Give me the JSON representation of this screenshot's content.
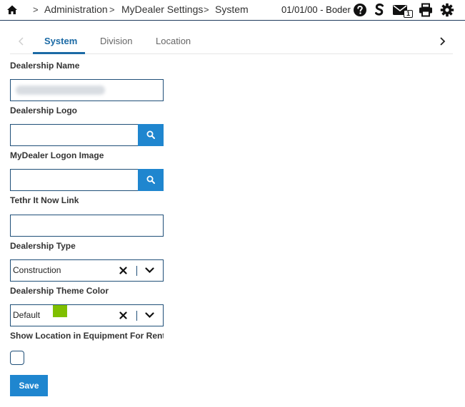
{
  "header": {
    "breadcrumb": [
      "Administration",
      "MyDealer Settings",
      "System"
    ],
    "separator": ">",
    "status_text": "01/01/00 - Boder",
    "mail_badge": "1",
    "icons": [
      "home-icon",
      "help-icon",
      "s-logo-icon",
      "mail-icon",
      "print-icon",
      "gear-icon"
    ]
  },
  "tabs": [
    {
      "label": "System",
      "active": true
    },
    {
      "label": "Division",
      "active": false
    },
    {
      "label": "Location",
      "active": false
    }
  ],
  "form": {
    "dealership_name": {
      "label": "Dealership Name",
      "value": ""
    },
    "dealership_logo": {
      "label": "Dealership Logo",
      "value": ""
    },
    "logon_image": {
      "label": "MyDealer Logon Image",
      "value": ""
    },
    "tethr_link": {
      "label": "Tethr It Now Link",
      "value": ""
    },
    "dealership_type": {
      "label": "Dealership Type",
      "value": "Construction"
    },
    "theme_color": {
      "label": "Dealership Theme Color",
      "value": "Default",
      "swatch": "#7fbf00"
    },
    "show_location": {
      "label": "Show Location in Equipment For Rent",
      "checked": false
    },
    "save_label": "Save"
  },
  "colors": {
    "accent": "#1f86cf",
    "tab_active": "#1b6aa5",
    "border": "#1f4f78"
  }
}
